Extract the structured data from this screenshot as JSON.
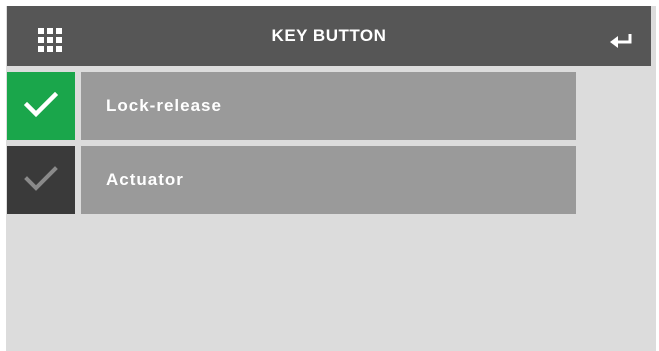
{
  "header": {
    "title": "KEY BUTTON",
    "menu_icon": "grid-icon",
    "enter_icon": "enter-arrow-icon"
  },
  "options": [
    {
      "label": "Lock-release",
      "checked": true,
      "icon": "checkmark-icon"
    },
    {
      "label": "Actuator",
      "checked": false,
      "icon": "checkmark-icon"
    }
  ],
  "colors": {
    "header_bg": "#565656",
    "screen_bg": "#dcdcdc",
    "checked_bg": "#1aa64b",
    "unchecked_bg": "#3a3a3a",
    "option_bg": "#9a9a9a",
    "unchecked_mark": "#8a8a8a"
  }
}
